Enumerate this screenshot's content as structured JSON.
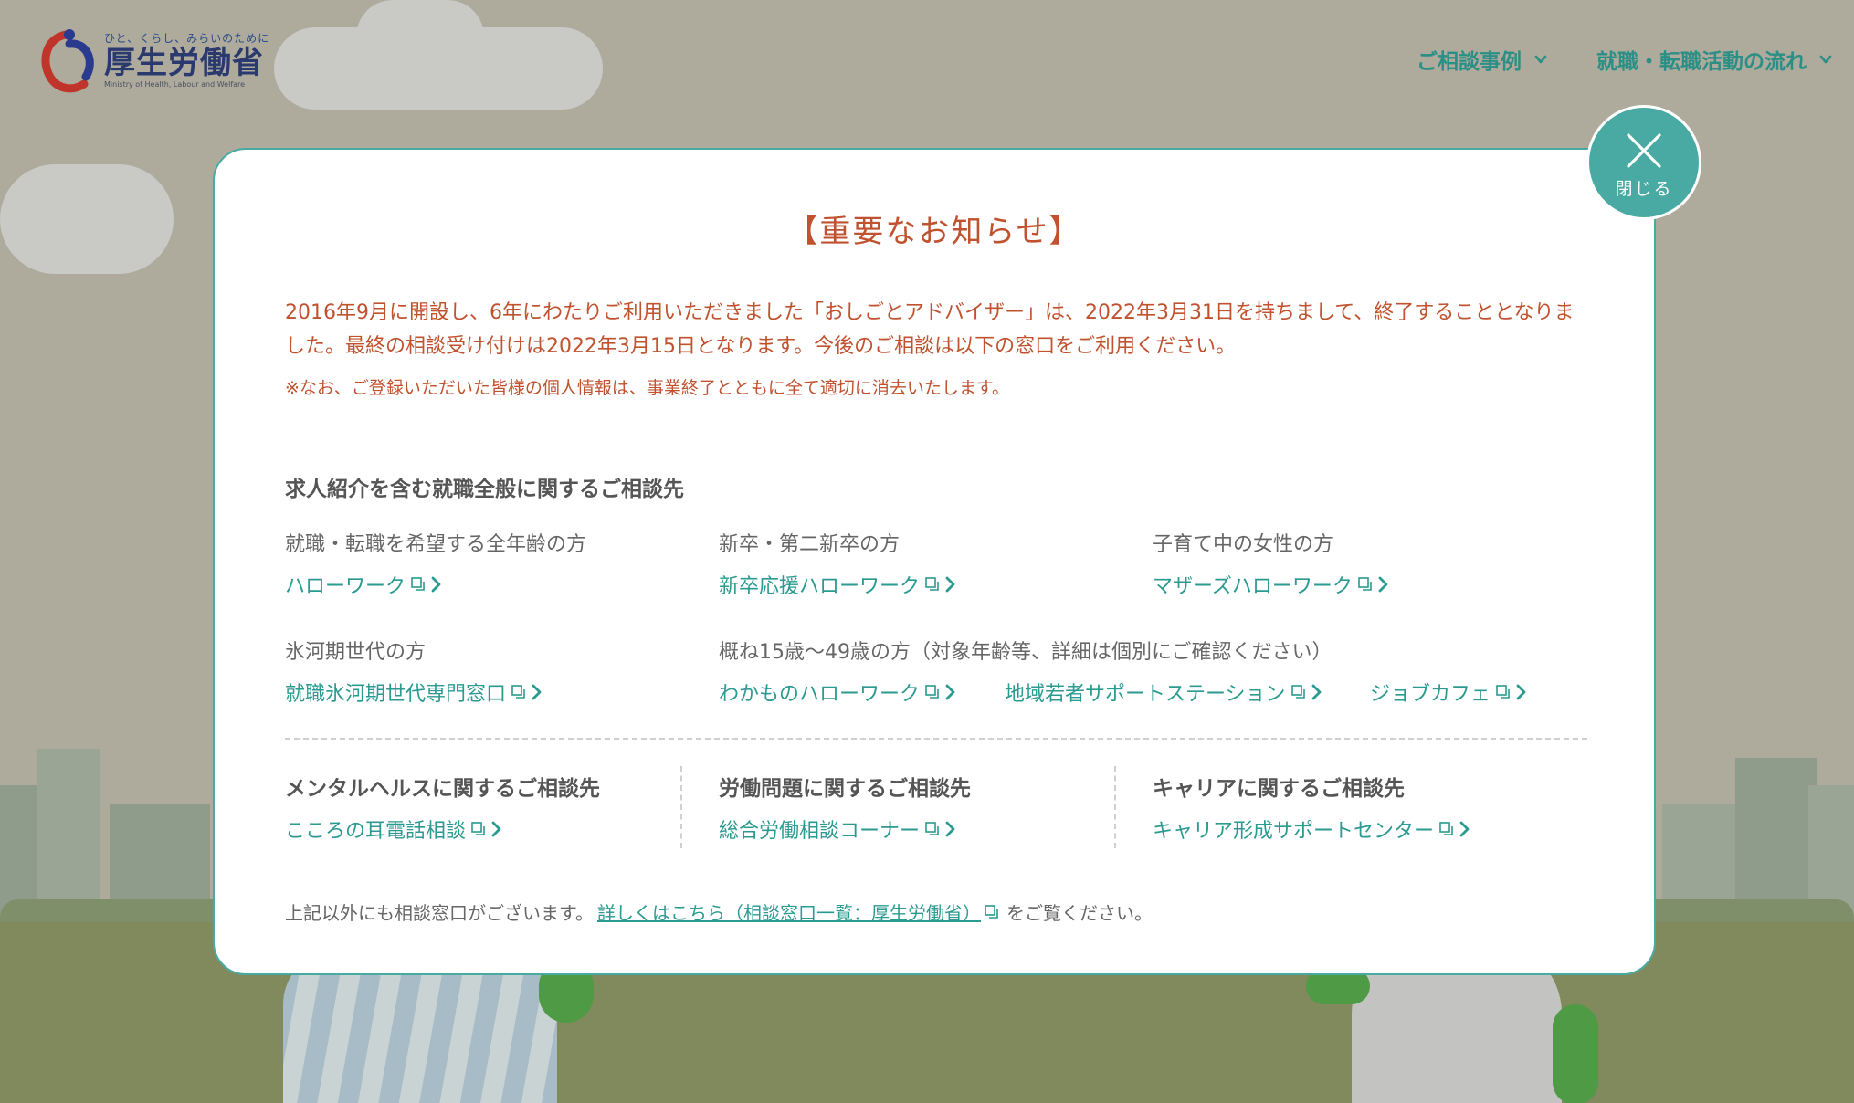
{
  "header": {
    "logo_tagline": "ひと、くらし、みらいのために",
    "logo_name": "厚生労働省",
    "logo_en": "Ministry of Health, Labour and Welfare",
    "nav": [
      {
        "label": "ご相談事例"
      },
      {
        "label": "就職・転職活動の流れ"
      }
    ]
  },
  "modal": {
    "close_label": "閉じる",
    "title": "【重要なお知らせ】",
    "notice": "2016年9月に開設し、6年にわたりご利用いただきました「おしごとアドバイザー」は、2022年3月31日を持ちまして、終了することとなりました。最終の相談受け付けは2022年3月15日となります。今後のご相談は以下の窓口をご利用ください。",
    "note": "※なお、ご登録いただいた皆様の個人情報は、事業終了とともに全て適切に消去いたします。",
    "job_section": {
      "title": "求人紹介を含む就職全般に関するご相談先",
      "groups": [
        {
          "label": "就職・転職を希望する全年齢の方",
          "links": [
            "ハローワーク"
          ]
        },
        {
          "label": "新卒・第二新卒の方",
          "links": [
            "新卒応援ハローワーク"
          ]
        },
        {
          "label": "子育て中の女性の方",
          "links": [
            "マザーズハローワーク"
          ]
        },
        {
          "label": "氷河期世代の方",
          "links": [
            "就職氷河期世代専門窓口"
          ]
        },
        {
          "label": "概ね15歳〜49歳の方（対象年齢等、詳細は個別にご確認ください）",
          "links": [
            "わかものハローワーク",
            "地域若者サポートステーション",
            "ジョブカフェ"
          ]
        }
      ]
    },
    "other_sections": [
      {
        "title": "メンタルヘルスに関するご相談先",
        "link": "こころの耳電話相談"
      },
      {
        "title": "労働問題に関するご相談先",
        "link": "総合労働相談コーナー"
      },
      {
        "title": "キャリアに関するご相談先",
        "link": "キャリア形成サポートセンター"
      }
    ],
    "footer": {
      "before": "上記以外にも相談窓口がございます。",
      "link": "詳しくはこちら（相談窓口一覧：厚生労働省）",
      "after": "をご覧ください。"
    }
  },
  "colors": {
    "accent": "#48aaa2",
    "link": "#2b9a90",
    "notice": "#c0522f"
  }
}
